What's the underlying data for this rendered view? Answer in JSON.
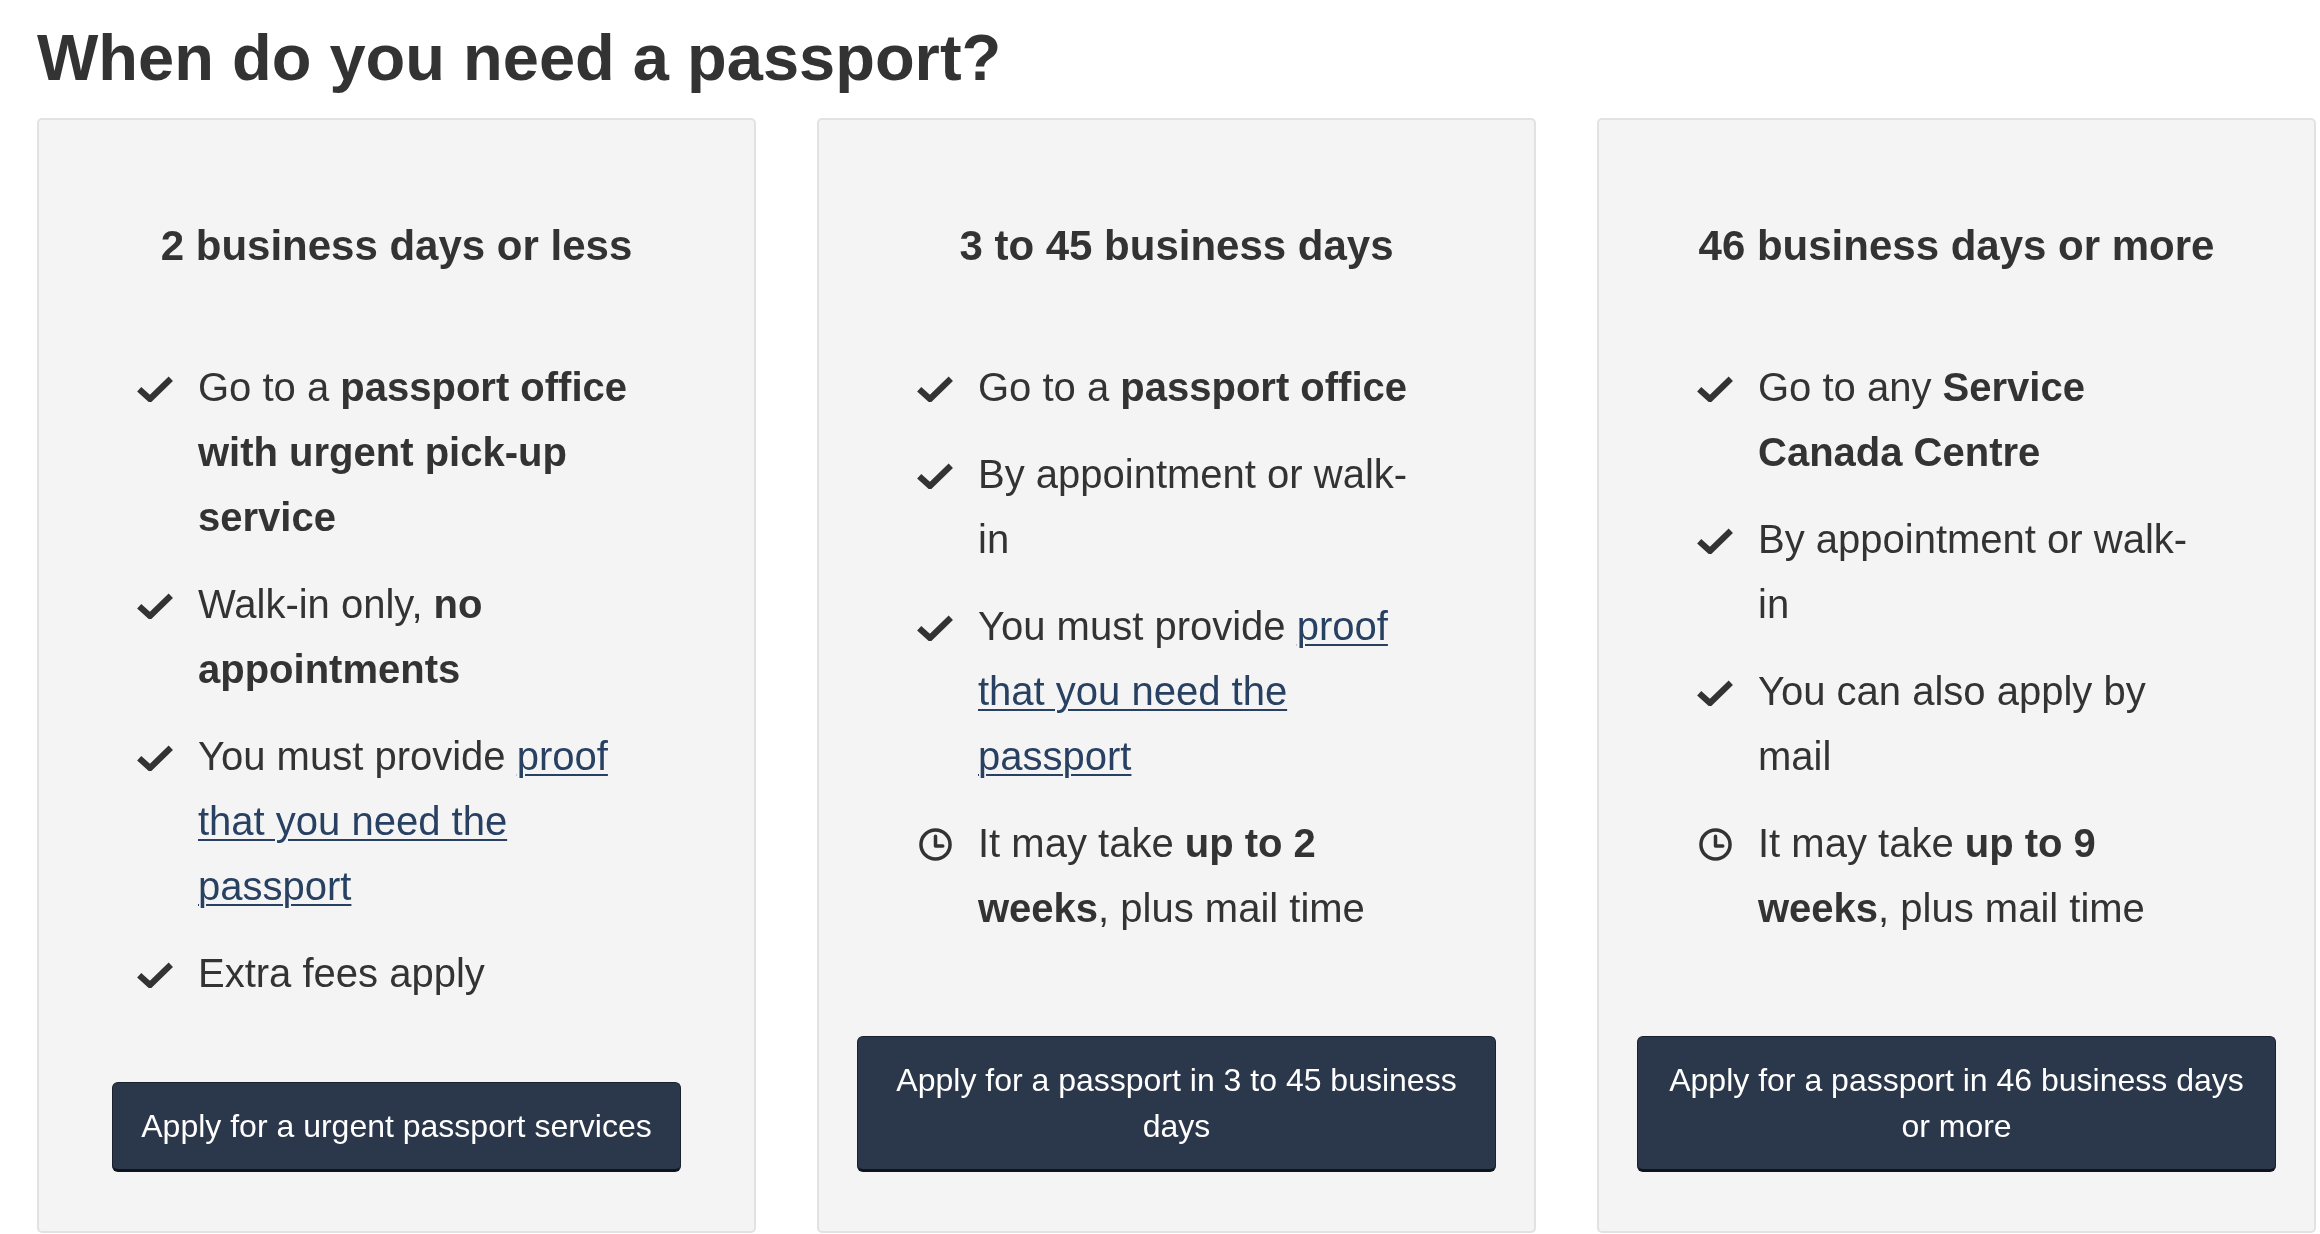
{
  "heading": "When do you need a passport?",
  "cards": [
    {
      "title": "2 business days or less",
      "items": [
        {
          "kind": "check",
          "text": "Go to a **passport office with urgent pick-up service**"
        },
        {
          "kind": "check",
          "text": "Walk-in only, **no appointments**"
        },
        {
          "kind": "check",
          "text": "You must provide",
          "link": "proof that you need the passport"
        },
        {
          "kind": "check",
          "text": "Extra fees apply"
        }
      ],
      "button": "Apply for a urgent passport services"
    },
    {
      "title": "3 to 45 business days",
      "items": [
        {
          "kind": "check",
          "text": "Go to a **passport office**"
        },
        {
          "kind": "check",
          "text": "By appointment or walk-in"
        },
        {
          "kind": "check",
          "text": "You must provide",
          "link": "proof that you need the passport"
        },
        {
          "kind": "clock",
          "text": "It may take **up to 2 weeks**, plus mail time"
        }
      ],
      "button": "Apply for a passport in 3 to 45 business days"
    },
    {
      "title": "46 business days or more",
      "items": [
        {
          "kind": "check",
          "text": "Go to any **Service Canada Centre**"
        },
        {
          "kind": "check",
          "text": "By appointment or walk-in"
        },
        {
          "kind": "check",
          "text": "You can also apply by mail"
        },
        {
          "kind": "clock",
          "text": "It may take **up to 9 weeks**, plus mail time"
        }
      ],
      "button": "Apply for a passport in 46 business days or more"
    }
  ]
}
